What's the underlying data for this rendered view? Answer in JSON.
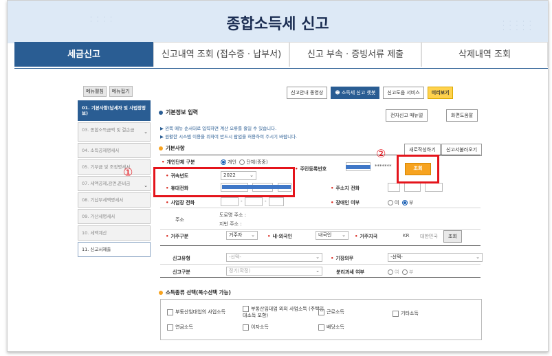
{
  "page": {
    "title": "종합소득세 신고"
  },
  "tabs": [
    {
      "label": "세금신고"
    },
    {
      "label": "신고내역 조회 (접수증 · 납부서)"
    },
    {
      "label": "신고 부속 · 증빙서류 제출"
    },
    {
      "label": "삭제내역 조회"
    }
  ],
  "menu": {
    "expand_label": "메뉴펼침",
    "collapse_label": "메뉴접기",
    "items": [
      {
        "label": "01. 기본사항(납세자 및 사업장정보)"
      },
      {
        "label": "03. 종합소득금액 및 결손금"
      },
      {
        "label": "04. 소득공제명세서"
      },
      {
        "label": "05. 기부금 및 조정명세서"
      },
      {
        "label": "07. 세액공제,감면,준비금"
      },
      {
        "label": "08. 기납부세액명세서"
      },
      {
        "label": "09. 가산세명세서"
      },
      {
        "label": "10. 세액계산"
      },
      {
        "label": "11. 신고서제출"
      }
    ]
  },
  "toolbar": {
    "video_label": "신고안내 동영상",
    "chatbot_label": "소득세 신고 챗봇",
    "help_label": "신고도움 서비스",
    "preview_label": "미리보기"
  },
  "basic_info": {
    "section_title": "기본정보 입력",
    "manual_label": "전자신고 매뉴얼",
    "screen_help_label": "화면도움말",
    "notes": [
      "왼쪽 메뉴 순서대로 입력하면 계산 오류를 줄일 수 있습니다.",
      "원활한 시스템 이용을 위하여 반드시 팝업을 허용하여 주시기 바랍니다."
    ],
    "subsection_title": "기본사항",
    "rewrite_label": "새로작성하기",
    "load_label": "신고서불러오기"
  },
  "form": {
    "person_type_label": "개인단체 구분",
    "person_type_options": [
      "개인",
      "단체(종중)"
    ],
    "resident_no_label": "주민등록번호",
    "resident_no_suffix": "*******",
    "lookup_label": "조회",
    "year_label": "귀속년도",
    "year_value": "2022",
    "mobile_label": "휴대전화",
    "home_phone_label": "주소지 전화",
    "biz_phone_label": "사업장 전화",
    "disabled_label": "장애인 여부",
    "disabled_options": [
      "여",
      "부"
    ],
    "address_label": "주소",
    "road_address_label": "도로명 주소 :",
    "lot_address_label": "지번 주소 :",
    "residence_label": "거주구분",
    "residence_value": "거주자",
    "nationality_label": "내·외국인",
    "nationality_value": "내국인",
    "country_label": "거주지국",
    "country_code": "KR",
    "country_name": "대한민국",
    "country_lookup_label": "조회",
    "report_type_label": "신고유형",
    "report_type_value": "-선택-",
    "bookkeeping_label": "기장의무",
    "bookkeeping_value": "-선택-",
    "report_class_label": "신고구분",
    "report_class_value": "정기(확정)",
    "separate_tax_label": "분리과세 여부",
    "separate_tax_options": [
      "여",
      "부"
    ]
  },
  "income_types": {
    "title": "소득종류 선택(복수선택 가능)",
    "items": [
      "부동산임대업의 사업소득",
      "부동산임대업 외의 사업소득 (주택임대소득 포함)",
      "근로소득",
      "기타소득",
      "연금소득",
      "이자소득",
      "배당소득"
    ]
  },
  "annotations": {
    "one": "①",
    "two": "②"
  },
  "colors": {
    "primary": "#2a5d93",
    "highlight": "#e4141b",
    "accent": "#f7a320"
  }
}
